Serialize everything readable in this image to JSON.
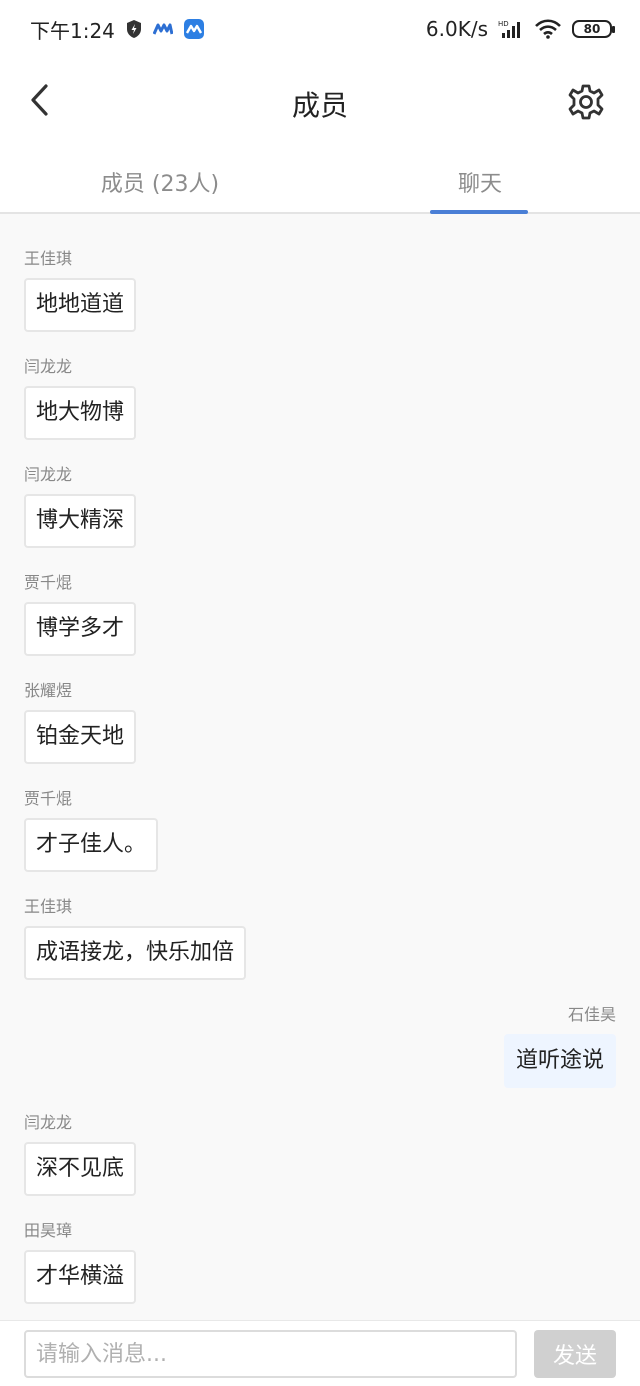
{
  "status_bar": {
    "time": "下午1:24",
    "net_speed": "6.0K/s",
    "battery": "80"
  },
  "header": {
    "title": "成员"
  },
  "tabs": [
    {
      "label": "成员 (23人)",
      "active": false
    },
    {
      "label": "聊天",
      "active": true
    }
  ],
  "messages": [
    {
      "sender": "王佳琪",
      "text": "地地道道"
    },
    {
      "sender": "闫龙龙",
      "text": "地大物博"
    },
    {
      "sender": "闫龙龙",
      "text": "博大精深"
    },
    {
      "sender": "贾千焜",
      "text": "博学多才"
    },
    {
      "sender": "张耀煜",
      "text": "铂金天地"
    },
    {
      "sender": "贾千焜",
      "text": "才子佳人。"
    },
    {
      "sender": "王佳琪",
      "text": "成语接龙，快乐加倍"
    },
    {
      "sender": "石佳昊",
      "text": "道听途说"
    },
    {
      "sender": "闫龙龙",
      "text": "深不见底"
    },
    {
      "sender": "田昊璋",
      "text": "才华横溢"
    }
  ],
  "input_bar": {
    "placeholder": "请输入消息...",
    "value": "",
    "send_label": "发送"
  },
  "colors": {
    "accent": "#4a7fd6",
    "self_bubble": "#eef5ff",
    "send_disabled": "#d0d0d0"
  },
  "icons": [
    "shield-icon",
    "app-logo-icon",
    "app-badge-icon",
    "signal-icon",
    "wifi-icon",
    "battery-icon",
    "back-chevron-icon",
    "gear-icon"
  ]
}
